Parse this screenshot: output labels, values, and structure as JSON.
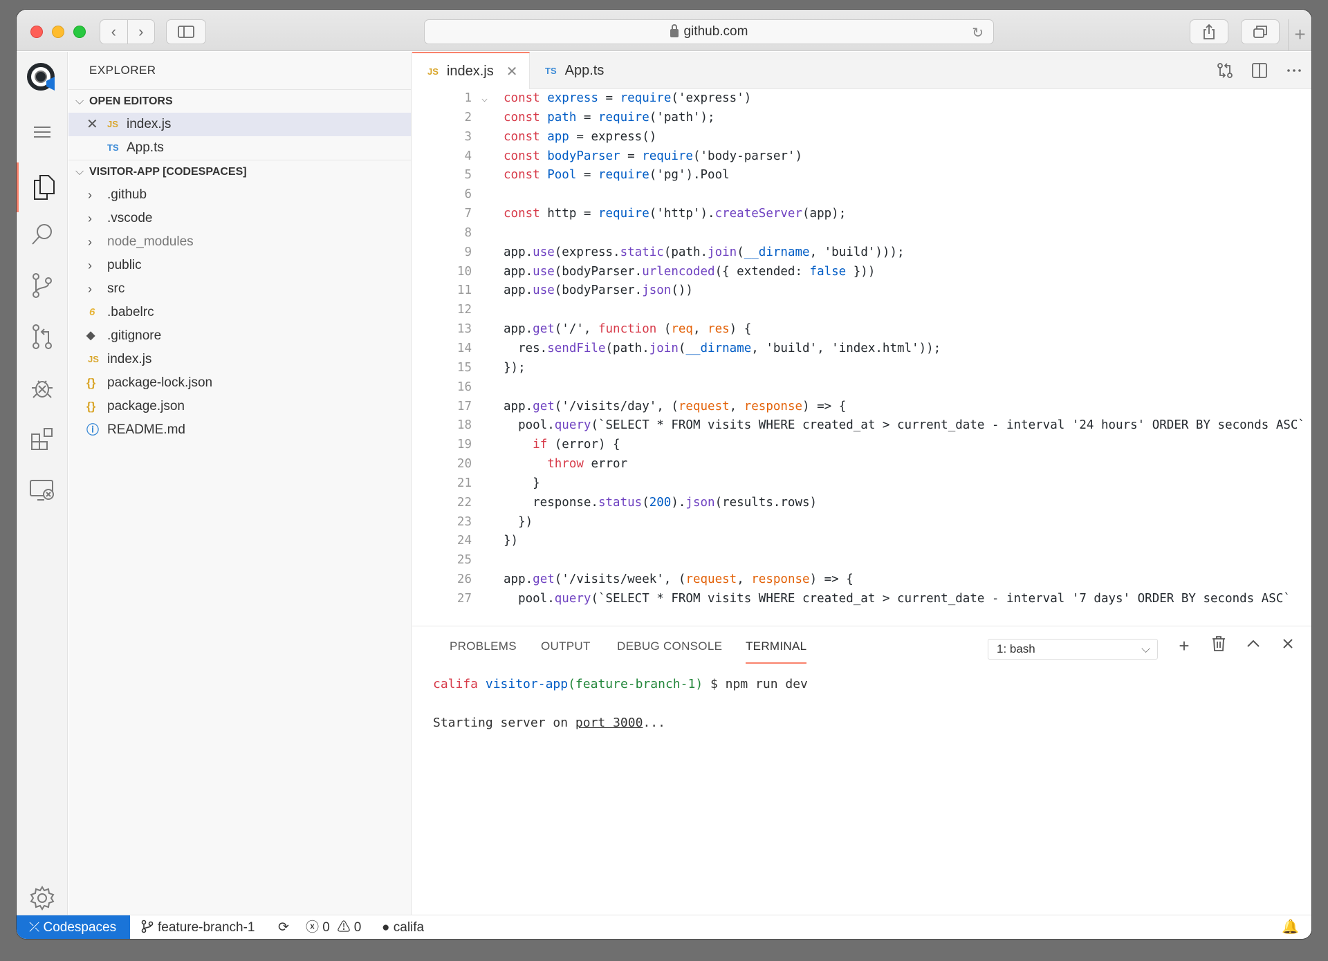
{
  "browser": {
    "url": "github.com",
    "back": "‹",
    "forward": "›",
    "reload": "↻",
    "new_tab": "+"
  },
  "explorer": {
    "title": "EXPLORER",
    "open_editors_title": "OPEN EDITORS",
    "open_editors": [
      {
        "tag": "JS",
        "name": "index.js"
      },
      {
        "tag": "TS",
        "name": "App.ts"
      }
    ],
    "project_title": "VISITOR-APP [CODESPACES]",
    "folders": [
      ".github",
      ".vscode",
      "node_modules",
      "public",
      "src"
    ],
    "files": [
      {
        "icon": "6",
        "name": ".babelrc"
      },
      {
        "icon": "◆",
        "name": ".gitignore"
      },
      {
        "icon": "JS",
        "name": "index.js"
      },
      {
        "icon": "{}",
        "name": "package-lock.json"
      },
      {
        "icon": "{}",
        "name": "package.json"
      },
      {
        "icon": "ⓘ",
        "name": "README.md"
      }
    ]
  },
  "editor": {
    "tabs": [
      {
        "tag": "JS",
        "label": "index.js",
        "active": true
      },
      {
        "tag": "TS",
        "label": "App.ts",
        "active": false
      }
    ],
    "line_numbers": [
      "1",
      "2",
      "3",
      "4",
      "5",
      "6",
      "7",
      "8",
      "9",
      "10",
      "11",
      "12",
      "13",
      "14",
      "15",
      "16",
      "17",
      "18",
      "19",
      "20",
      "21",
      "22",
      "23",
      "24",
      "25",
      "26",
      "27"
    ]
  },
  "panel": {
    "tabs": [
      "PROBLEMS",
      "OUTPUT",
      "DEBUG CONSOLE",
      "TERMINAL"
    ],
    "active_tab": "TERMINAL",
    "terminal_select": "1: bash",
    "prompt_user": "califa",
    "prompt_dir": "visitor-app",
    "prompt_branch": "(feature-branch-1)",
    "prompt_command": " $ npm run dev",
    "output_prefix": "Starting server on ",
    "output_link": "port 3000",
    "output_suffix": "..."
  },
  "statusbar": {
    "remote": "Codespaces",
    "branch": "feature-branch-1",
    "errors": "0",
    "warnings": "0",
    "user": "califa"
  },
  "colors": {
    "accent": "#f9826c",
    "remote_bg": "#1a74d8",
    "keyword": "#d73a49",
    "function": "#005cc5",
    "param": "#e36209"
  }
}
